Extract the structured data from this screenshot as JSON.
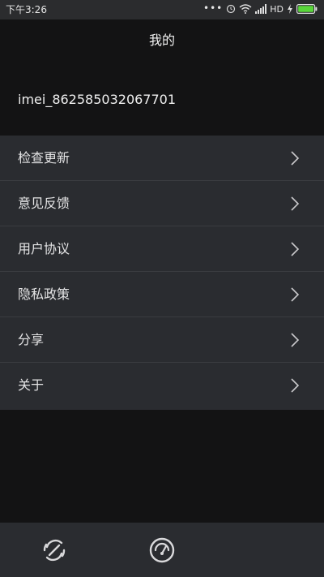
{
  "status_bar": {
    "time": "下午3:26",
    "signal_dots": "•••",
    "network": "HD",
    "icons": [
      "alarm-icon",
      "wifi-icon",
      "signal-icon",
      "charging-icon",
      "battery-icon"
    ]
  },
  "header": {
    "title": "我的"
  },
  "account": {
    "id": "imei_862585032067701"
  },
  "menu": {
    "items": [
      {
        "label": "检查更新",
        "icon": "chevron-right-icon"
      },
      {
        "label": "意见反馈",
        "icon": "chevron-right-icon"
      },
      {
        "label": "用户协议",
        "icon": "chevron-right-icon"
      },
      {
        "label": "隐私政策",
        "icon": "chevron-right-icon"
      },
      {
        "label": "分享",
        "icon": "chevron-right-icon"
      },
      {
        "label": "关于",
        "icon": "chevron-right-icon"
      }
    ]
  },
  "bottom_nav": {
    "items": [
      {
        "icon": "link-off-icon"
      },
      {
        "icon": "gauge-icon"
      }
    ]
  },
  "colors": {
    "background": "#131314",
    "panel": "#2a2c30",
    "status_bar": "#2b2c2e",
    "divider": "#3a3c40",
    "text": "#e4e4e5",
    "battery_green": "#59d63a"
  }
}
